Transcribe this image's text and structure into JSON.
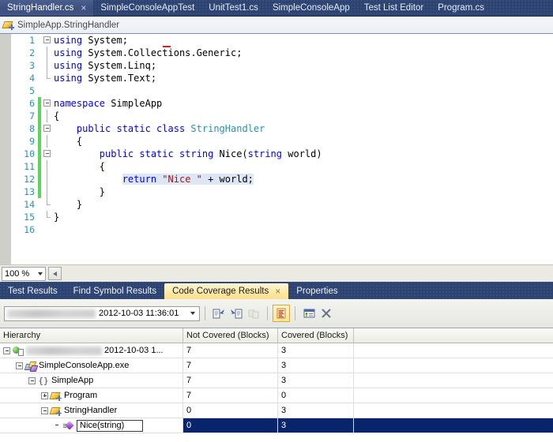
{
  "document_tabs": [
    {
      "label": "StringHandler.cs",
      "active": true,
      "close": "×"
    },
    {
      "label": "SimpleConsoleAppTest",
      "active": false
    },
    {
      "label": "UnitTest1.cs",
      "active": false
    },
    {
      "label": "SimpleConsoleApp",
      "active": false
    },
    {
      "label": "Test List Editor",
      "active": false
    },
    {
      "label": "Program.cs",
      "active": false
    }
  ],
  "navbar": {
    "icon": "class-icon",
    "label": "SimpleApp.StringHandler"
  },
  "editor": {
    "zoom_level": "100 %",
    "lines": [
      {
        "num": "1",
        "changed": false,
        "outline": "collapse",
        "tokens": [
          {
            "t": "using",
            "c": "kw"
          },
          {
            "t": " System;",
            "c": "txt"
          }
        ]
      },
      {
        "num": "2",
        "changed": false,
        "outline": "line",
        "tokens": [
          {
            "t": "using",
            "c": "kw"
          },
          {
            "t": " System.Collections.Generic;",
            "c": "txt"
          }
        ]
      },
      {
        "num": "3",
        "changed": false,
        "outline": "line",
        "tokens": [
          {
            "t": "using",
            "c": "kw"
          },
          {
            "t": " System.Linq;",
            "c": "txt"
          }
        ]
      },
      {
        "num": "4",
        "changed": false,
        "outline": "endline",
        "tokens": [
          {
            "t": "using",
            "c": "kw"
          },
          {
            "t": " System.Text;",
            "c": "txt"
          }
        ]
      },
      {
        "num": "5",
        "changed": false,
        "outline": "none",
        "tokens": []
      },
      {
        "num": "6",
        "changed": true,
        "outline": "collapse",
        "tokens": [
          {
            "t": "namespace",
            "c": "kw"
          },
          {
            "t": " SimpleApp",
            "c": "txt"
          }
        ]
      },
      {
        "num": "7",
        "changed": true,
        "outline": "line",
        "tokens": [
          {
            "t": "{",
            "c": "txt"
          }
        ]
      },
      {
        "num": "8",
        "changed": true,
        "outline": "collapse",
        "tokens": [
          {
            "t": "    ",
            "c": "txt"
          },
          {
            "t": "public static class",
            "c": "kw"
          },
          {
            "t": " ",
            "c": "txt"
          },
          {
            "t": "StringHandler",
            "c": "typ"
          }
        ]
      },
      {
        "num": "9",
        "changed": true,
        "outline": "line",
        "tokens": [
          {
            "t": "    {",
            "c": "txt"
          }
        ]
      },
      {
        "num": "10",
        "changed": true,
        "outline": "collapse",
        "tokens": [
          {
            "t": "        ",
            "c": "txt"
          },
          {
            "t": "public static string",
            "c": "kw"
          },
          {
            "t": " Nice(",
            "c": "txt"
          },
          {
            "t": "string",
            "c": "kw"
          },
          {
            "t": " world)",
            "c": "txt"
          }
        ]
      },
      {
        "num": "11",
        "changed": true,
        "outline": "line",
        "tokens": [
          {
            "t": "        {",
            "c": "txt"
          }
        ]
      },
      {
        "num": "12",
        "changed": true,
        "outline": "line",
        "tokens": [
          {
            "t": "            ",
            "c": "txt"
          },
          {
            "t": "return",
            "c": "kw hl"
          },
          {
            "t": " ",
            "c": "hl"
          },
          {
            "t": "\"Nice \"",
            "c": "str hl"
          },
          {
            "t": " + world;",
            "c": "txt hl"
          }
        ]
      },
      {
        "num": "13",
        "changed": true,
        "outline": "line",
        "tokens": [
          {
            "t": "        }",
            "c": "txt"
          }
        ]
      },
      {
        "num": "14",
        "changed": false,
        "outline": "endline",
        "tokens": [
          {
            "t": "    }",
            "c": "txt"
          }
        ]
      },
      {
        "num": "15",
        "changed": false,
        "outline": "endline",
        "tokens": [
          {
            "t": "}",
            "c": "txt"
          }
        ]
      },
      {
        "num": "16",
        "changed": false,
        "outline": "none",
        "tokens": []
      }
    ]
  },
  "panel_tabs": [
    {
      "label": "Test Results",
      "active": false
    },
    {
      "label": "Find Symbol Results",
      "active": false
    },
    {
      "label": "Code Coverage Results",
      "active": true,
      "close": "×"
    },
    {
      "label": "Properties",
      "active": false
    }
  ],
  "coverage_toolbar": {
    "run_selector_value": "2012-10-03 11:36:01",
    "buttons": [
      {
        "name": "export-results-icon",
        "checked": false
      },
      {
        "name": "import-results-icon",
        "checked": false
      },
      {
        "name": "merge-results-icon",
        "checked": false,
        "disabled": true
      },
      {
        "name": "show-code-coverage-coloring-icon",
        "checked": true
      },
      {
        "name": "add-remove-columns-icon",
        "checked": false
      },
      {
        "name": "delete-icon",
        "checked": false
      }
    ]
  },
  "coverage_grid": {
    "columns": [
      "Hierarchy",
      "Not Covered (Blocks)",
      "Covered (Blocks)",
      ""
    ],
    "rows": [
      {
        "indent": 0,
        "expander": "minus",
        "icon": "coverage-result-icon",
        "blurred_prefix": true,
        "label": "2012-10-03 1...",
        "not_covered": "7",
        "covered": "3",
        "selected": false,
        "editing": false
      },
      {
        "indent": 1,
        "expander": "minus",
        "icon": "assembly-icon",
        "blurred_prefix": false,
        "label": "SimpleConsoleApp.exe",
        "not_covered": "7",
        "covered": "3",
        "selected": false,
        "editing": false
      },
      {
        "indent": 2,
        "expander": "minus",
        "icon": "namespace-icon",
        "blurred_prefix": false,
        "label": "SimpleApp",
        "not_covered": "7",
        "covered": "3",
        "selected": false,
        "editing": false
      },
      {
        "indent": 3,
        "expander": "plus",
        "icon": "class-icon",
        "blurred_prefix": false,
        "label": "Program",
        "not_covered": "7",
        "covered": "0",
        "selected": false,
        "editing": false
      },
      {
        "indent": 3,
        "expander": "minus",
        "icon": "class-icon",
        "blurred_prefix": false,
        "label": "StringHandler",
        "not_covered": "0",
        "covered": "3",
        "selected": false,
        "editing": false
      },
      {
        "indent": 4,
        "expander": "none",
        "icon": "method-icon",
        "blurred_prefix": false,
        "label": "Nice(string)",
        "not_covered": "0",
        "covered": "3",
        "selected": true,
        "editing": true
      }
    ]
  }
}
